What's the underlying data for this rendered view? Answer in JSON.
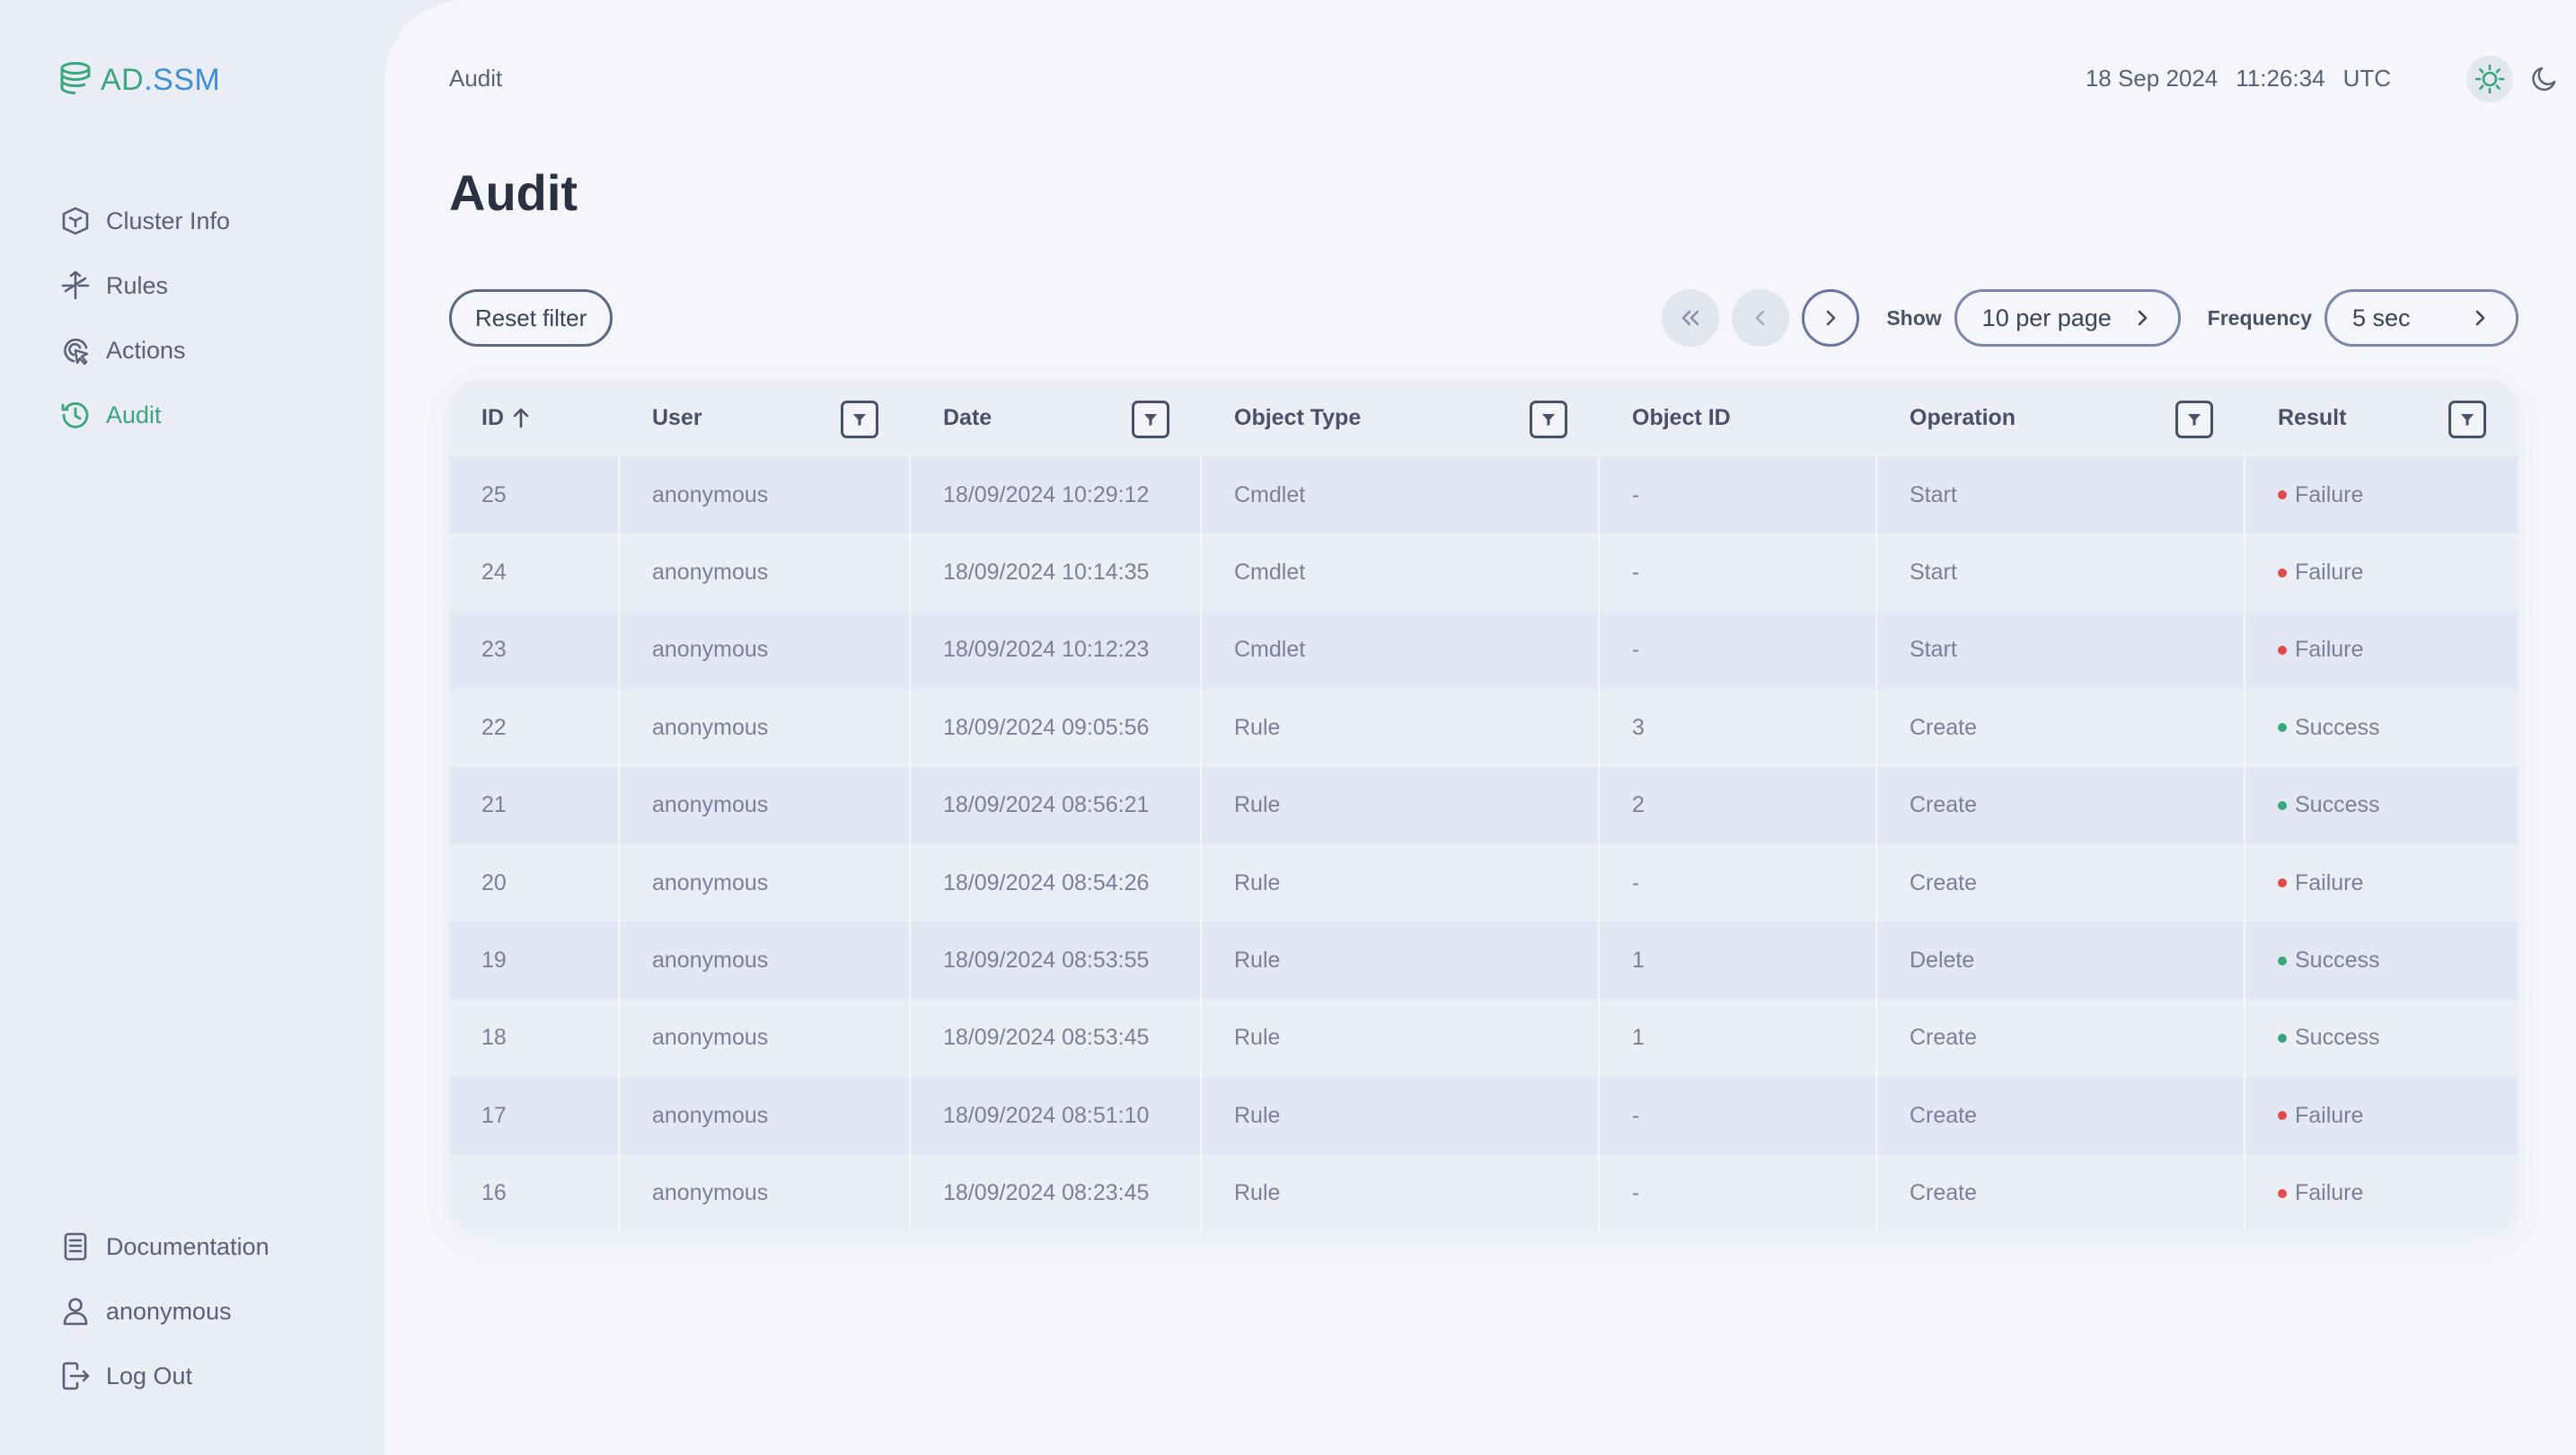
{
  "app": {
    "logo_prefix": "AD",
    "logo_suffix": ".SSM"
  },
  "sidebar": {
    "items": [
      {
        "label": "Cluster Info",
        "icon": "cube-icon"
      },
      {
        "label": "Rules",
        "icon": "routes-icon"
      },
      {
        "label": "Actions",
        "icon": "cursor-click-icon"
      },
      {
        "label": "Audit",
        "icon": "audit-history-icon",
        "active": true
      }
    ],
    "bottom": [
      {
        "label": "Documentation",
        "icon": "document-icon"
      },
      {
        "label": "anonymous",
        "icon": "user-icon"
      },
      {
        "label": "Log Out",
        "icon": "logout-icon"
      }
    ]
  },
  "header": {
    "breadcrumb": "Audit",
    "date": "18 Sep 2024",
    "time": "11:26:34",
    "timezone": "UTC"
  },
  "page": {
    "title": "Audit",
    "reset_filter": "Reset filter",
    "show_label": "Show",
    "per_page": "10 per page",
    "frequency_label": "Frequency",
    "frequency": "5 sec"
  },
  "table": {
    "columns": [
      "ID",
      "User",
      "Date",
      "Object Type",
      "Object ID",
      "Operation",
      "Result"
    ],
    "rows": [
      {
        "id": "25",
        "user": "anonymous",
        "date": "18/09/2024 10:29:12",
        "object_type": "Cmdlet",
        "object_id": "-",
        "operation": "Start",
        "result": "Failure"
      },
      {
        "id": "24",
        "user": "anonymous",
        "date": "18/09/2024 10:14:35",
        "object_type": "Cmdlet",
        "object_id": "-",
        "operation": "Start",
        "result": "Failure"
      },
      {
        "id": "23",
        "user": "anonymous",
        "date": "18/09/2024 10:12:23",
        "object_type": "Cmdlet",
        "object_id": "-",
        "operation": "Start",
        "result": "Failure"
      },
      {
        "id": "22",
        "user": "anonymous",
        "date": "18/09/2024 09:05:56",
        "object_type": "Rule",
        "object_id": "3",
        "operation": "Create",
        "result": "Success"
      },
      {
        "id": "21",
        "user": "anonymous",
        "date": "18/09/2024 08:56:21",
        "object_type": "Rule",
        "object_id": "2",
        "operation": "Create",
        "result": "Success"
      },
      {
        "id": "20",
        "user": "anonymous",
        "date": "18/09/2024 08:54:26",
        "object_type": "Rule",
        "object_id": "-",
        "operation": "Create",
        "result": "Failure"
      },
      {
        "id": "19",
        "user": "anonymous",
        "date": "18/09/2024 08:53:55",
        "object_type": "Rule",
        "object_id": "1",
        "operation": "Delete",
        "result": "Success"
      },
      {
        "id": "18",
        "user": "anonymous",
        "date": "18/09/2024 08:53:45",
        "object_type": "Rule",
        "object_id": "1",
        "operation": "Create",
        "result": "Success"
      },
      {
        "id": "17",
        "user": "anonymous",
        "date": "18/09/2024 08:51:10",
        "object_type": "Rule",
        "object_id": "-",
        "operation": "Create",
        "result": "Failure"
      },
      {
        "id": "16",
        "user": "anonymous",
        "date": "18/09/2024 08:23:45",
        "object_type": "Rule",
        "object_id": "-",
        "operation": "Create",
        "result": "Failure"
      }
    ]
  },
  "colors": {
    "accent": "#3aa77a",
    "success": "#3aa77a",
    "failure": "#e04b4b"
  }
}
